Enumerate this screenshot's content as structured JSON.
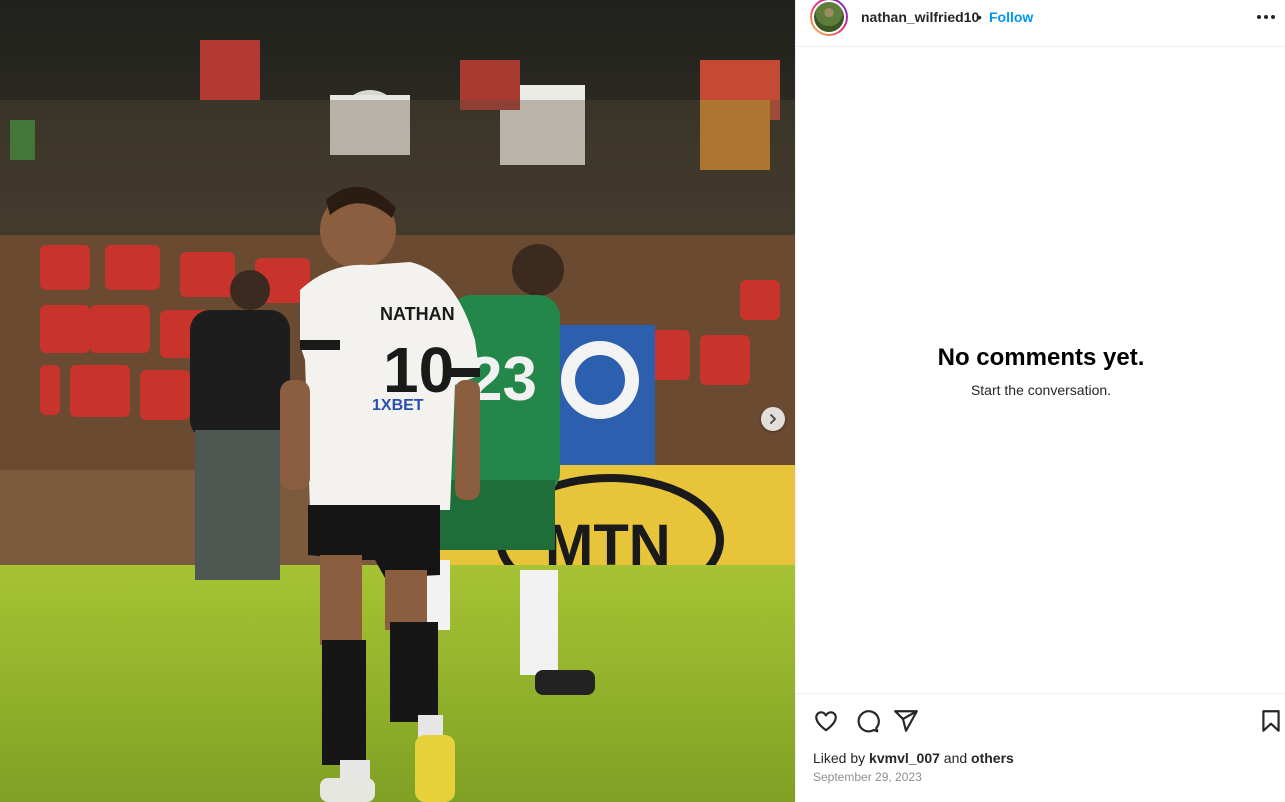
{
  "post": {
    "username": "nathan_wilfried10",
    "separator": "•",
    "follow_label": "Follow",
    "media": {
      "jersey_name": "NATHAN",
      "jersey_number": "10",
      "sponsor": "1XBET",
      "opponent_number": "23",
      "banner_text": "MTN"
    }
  },
  "comments": {
    "empty_title": "No comments yet.",
    "empty_subtitle": "Start the conversation."
  },
  "footer": {
    "liked_by_prefix": "Liked by ",
    "liked_by_user": "kvmvl_007",
    "liked_by_middle": " and ",
    "liked_by_others": "others",
    "date": "September 29, 2023"
  }
}
